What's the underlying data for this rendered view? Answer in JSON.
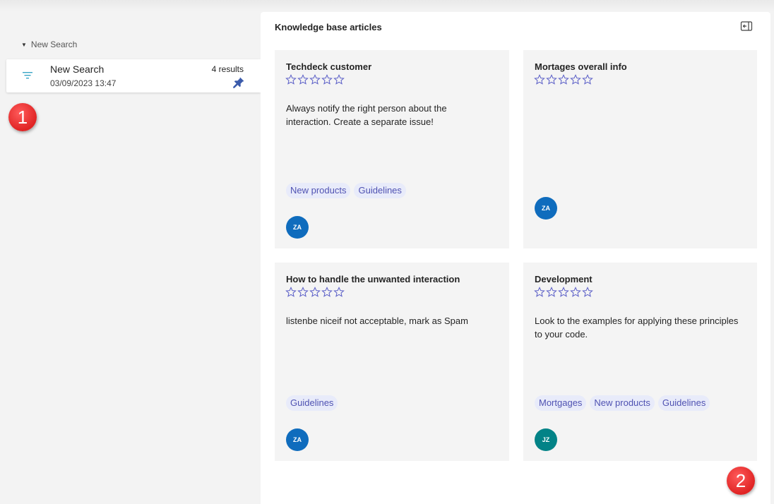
{
  "sidebar": {
    "group_label": "New Search",
    "search_item": {
      "name": "New Search",
      "date": "03/09/2023 13:47",
      "count": "4 results"
    }
  },
  "panel": {
    "title": "Knowledge base articles"
  },
  "articles": [
    {
      "title": "Techdeck customer",
      "rating": 0,
      "description": "Always notify the right person about the interaction. Create a separate issue!",
      "tags": [
        "New products",
        "Guidelines"
      ],
      "author_initials": "ZA",
      "avatar_color": "#0f6cbd"
    },
    {
      "title": "Mortages overall info",
      "rating": 0,
      "description": "",
      "tags": [],
      "author_initials": "ZA",
      "avatar_color": "#0f6cbd"
    },
    {
      "title": "How to handle the unwanted interaction",
      "rating": 0,
      "description": "listenbe niceif not acceptable, mark as Spam",
      "tags": [
        "Guidelines"
      ],
      "author_initials": "ZA",
      "avatar_color": "#0f6cbd"
    },
    {
      "title": "Development",
      "rating": 0,
      "description": "Look to the examples for applying these principles to your code.",
      "tags": [
        "Mortgages",
        "New products",
        "Guidelines"
      ],
      "author_initials": "JZ",
      "avatar_color": "#038387"
    }
  ],
  "annotations": [
    "1",
    "2"
  ],
  "colors": {
    "accent": "#4f52b2",
    "filter_icon": "#3aa6c6",
    "pin_icon": "#3b5bab",
    "marker": "#e02424"
  }
}
